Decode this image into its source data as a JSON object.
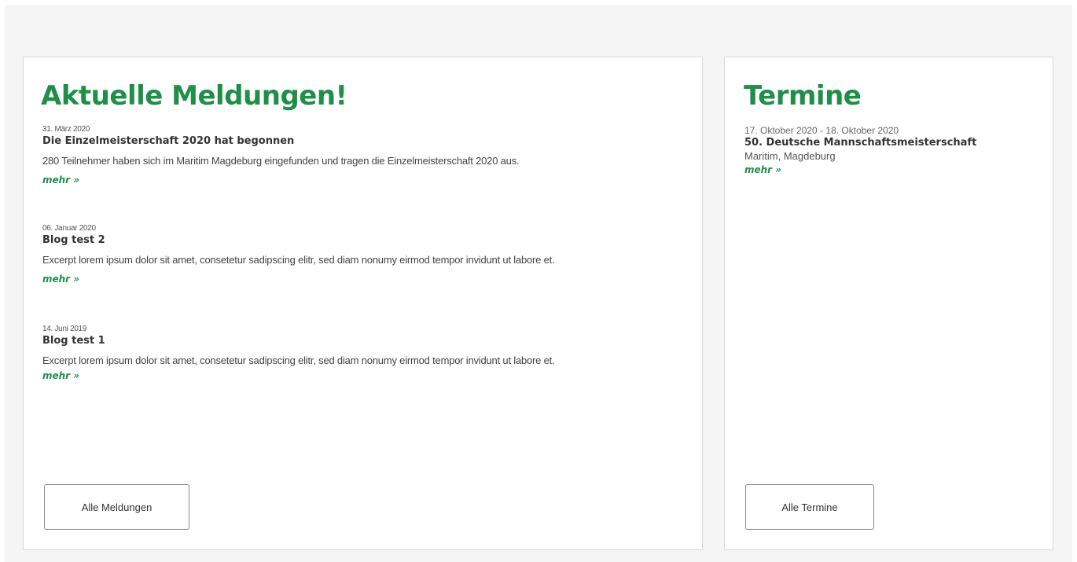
{
  "news": {
    "title": "Aktuelle Meldungen!",
    "entries": [
      {
        "date": "31. März 2020",
        "title": "Die Einzelmeisterschaft 2020 hat begonnen",
        "excerpt": "280 Teilnehmer haben sich im Maritim Magdeburg eingefunden und tragen die Einzelmeisterschaft 2020 aus.",
        "more": "mehr »"
      },
      {
        "date": "06. Januar 2020",
        "title": "Blog test 2",
        "excerpt": "Excerpt lorem ipsum dolor sit amet, consetetur sadipscing elitr, sed diam nonumy eirmod tempor invidunt ut labore et.",
        "more": "mehr »"
      },
      {
        "date": "14. Juni 2019",
        "title": "Blog test 1",
        "excerpt": "Excerpt lorem ipsum dolor sit amet, consetetur sadipscing elitr, sed diam nonumy eirmod tempor invidunt ut labore et.",
        "more": "mehr »"
      }
    ],
    "button_label": "Alle Meldungen"
  },
  "events": {
    "title": "Termine",
    "items": [
      {
        "date": "17. Oktober 2020 - 18. Oktober 2020",
        "title": "50. Deutsche Mannschaftsmeisterschaft",
        "location": "Maritim, Magdeburg",
        "more": "mehr »"
      }
    ],
    "button_label": "Alle Termine"
  },
  "colors": {
    "accent": "#1f8f47",
    "page_background": "#f5f5f5",
    "card_border": "#d9d9d9"
  }
}
